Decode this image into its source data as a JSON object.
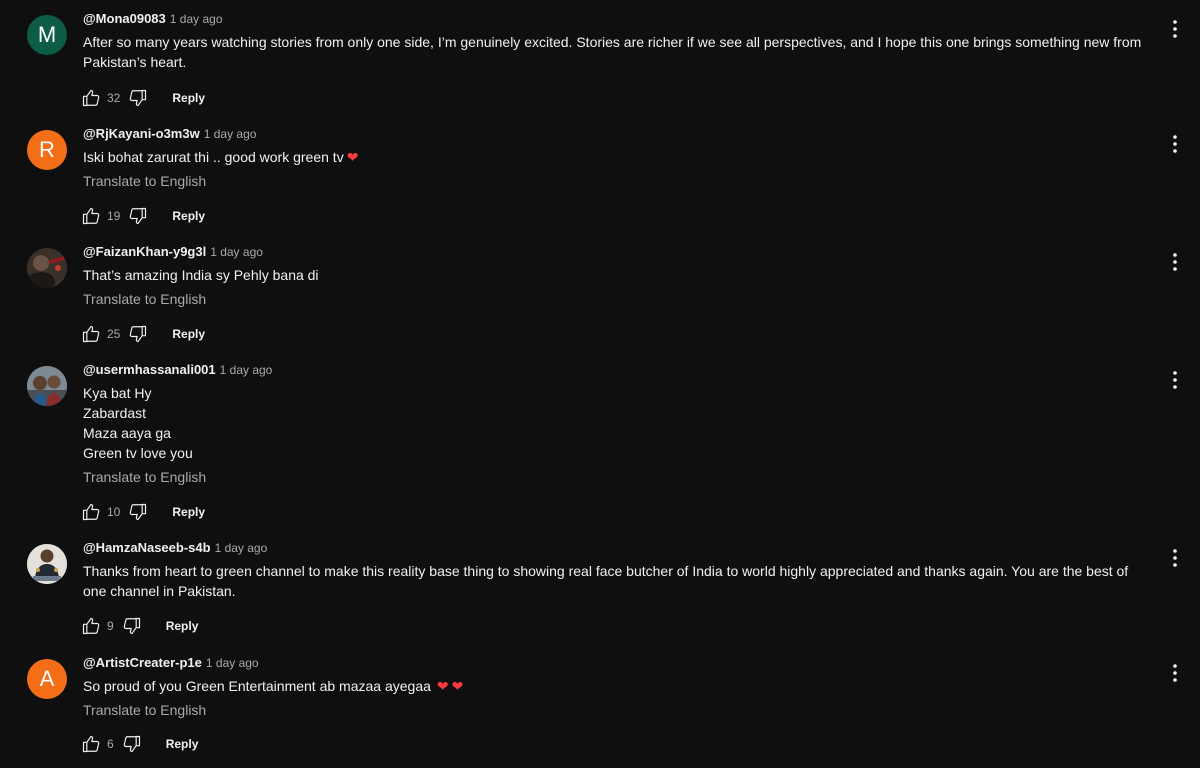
{
  "colors": {
    "background": "#0f0f0f",
    "text": "#f1f1f1",
    "muted": "#aaaaaa",
    "heart": "#ff3b3b"
  },
  "labels": {
    "translate": "Translate to English",
    "reply": "Reply"
  },
  "comments": [
    {
      "author": "@Mona09083",
      "time": "1 day ago",
      "avatar_letter": "M",
      "avatar_color": "#0d5c46",
      "lines": [
        "After so many years watching stories from only one side, I’m genuinely excited. Stories are richer if we see all perspectives, and I hope this one brings something new from",
        "Pakistan’s heart."
      ],
      "likes": "32"
    },
    {
      "author": "@RjKayani-o3m3w",
      "time": "1 day ago",
      "avatar_letter": "R",
      "avatar_color": "#f36e17",
      "lines": [
        "Iski bohat zarurat thi .. good work green tv"
      ],
      "likes": "19"
    },
    {
      "author": "@FaizanKhan-y9g3l",
      "time": "1 day ago",
      "lines": [
        "That’s amazing India sy Pehly bana di"
      ],
      "likes": "25"
    },
    {
      "author": "@usermhassanali001",
      "time": "1 day ago",
      "lines": [
        "Kya bat Hy",
        "Zabardast",
        "Maza aaya ga",
        "Green tv love you"
      ],
      "likes": "10"
    },
    {
      "author": "@HamzaNaseeb-s4b",
      "time": "1 day ago",
      "lines": [
        "Thanks from heart to green channel to make this reality base thing to showing real face butcher of India to world highly appreciated and thanks again. You are the best of",
        "one channel in Pakistan."
      ],
      "likes": "9"
    },
    {
      "author": "@ArtistCreater-p1e",
      "time": "1 day ago",
      "avatar_letter": "A",
      "avatar_color": "#f36e17",
      "lines": [
        "So proud of you Green Entertainment ab mazaa ayegaa"
      ],
      "likes": "6"
    }
  ]
}
